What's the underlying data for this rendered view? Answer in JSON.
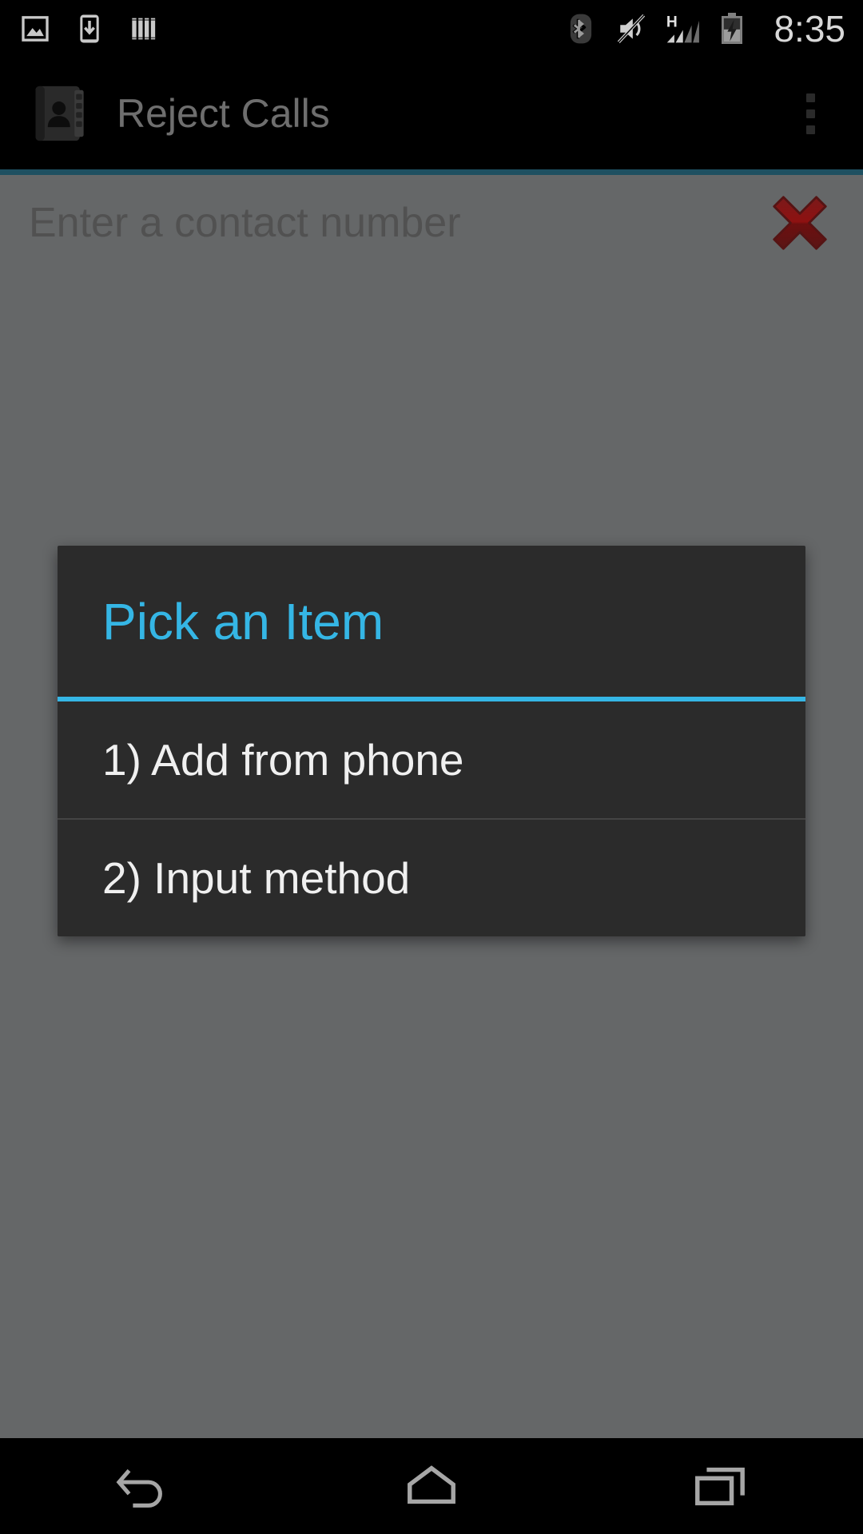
{
  "status_bar": {
    "clock": "8:35",
    "notification_icons": [
      {
        "name": "screenshot-image-icon",
        "label": "Screenshot"
      },
      {
        "name": "download-to-device-icon",
        "label": "Download"
      },
      {
        "name": "barcode-bars-icon",
        "label": "Barcode"
      }
    ],
    "system_icons": [
      {
        "name": "bluetooth-icon",
        "label": "Bluetooth"
      },
      {
        "name": "volume-mute-icon",
        "label": "Silent"
      },
      {
        "name": "network-hspa-icon",
        "label": "H"
      },
      {
        "name": "signal-bars-icon",
        "label": "Signal",
        "bars_filled": 2,
        "bars_total": 4
      },
      {
        "name": "battery-charging-icon",
        "label": "Charging"
      }
    ]
  },
  "action_bar": {
    "app_icon": "contacts-book-icon",
    "title": "Reject Calls",
    "overflow_label": "More options"
  },
  "content": {
    "contact_input": {
      "placeholder": "Enter a contact number",
      "value": "",
      "clear_icon": "red-x-clear-icon"
    }
  },
  "dialog": {
    "title": "Pick an Item",
    "title_color": "#35b6e5",
    "background_color": "#2b2b2b",
    "items": [
      {
        "label": "1) Add from phone"
      },
      {
        "label": "2) Input method"
      }
    ]
  },
  "nav_bar": {
    "buttons": [
      {
        "name": "back-button",
        "label": "Back"
      },
      {
        "name": "home-button",
        "label": "Home"
      },
      {
        "name": "recents-button",
        "label": "Recent apps"
      }
    ]
  },
  "colors": {
    "accent": "#35b6e5",
    "accent_line": "#1e5061",
    "scrim_background": "#656768",
    "bar_background": "#000000"
  }
}
